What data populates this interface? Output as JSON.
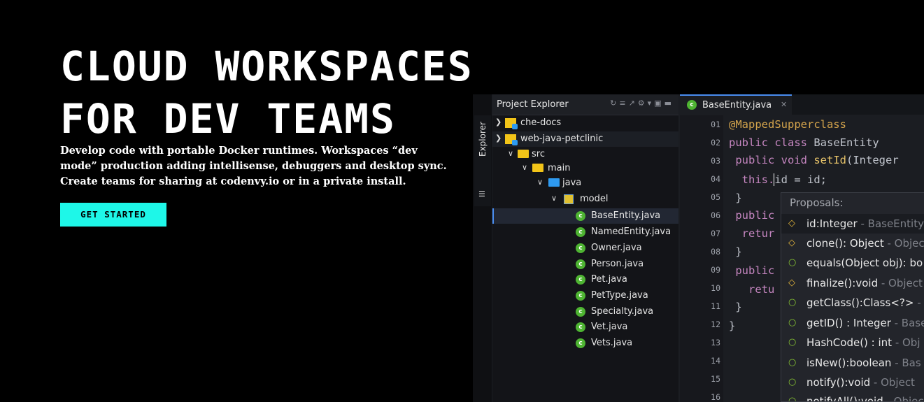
{
  "hero": {
    "title_line1": "CLOUD WORKSPACES",
    "title_line2": "FOR DEV TEAMS",
    "description": "Develop code with portable Docker runtimes. Workspaces “dev mode” production adding intellisense, debuggers and desktop sync. Create teams for sharing at codenvy.io or in a private install.",
    "cta_label": "GET STARTED"
  },
  "colors": {
    "accent": "#1ef7e8",
    "background": "#000000",
    "class_icon": "#4eb432",
    "folder": "#f2c418"
  },
  "ide": {
    "side_tab": {
      "label": "Explorer",
      "icon": "explorer-icon"
    },
    "explorer": {
      "title": "Project Explorer",
      "tool_icons": [
        "refresh-icon",
        "collapse-icon",
        "link-icon",
        "gear-icon",
        "maximize-icon",
        "minimize-icon"
      ],
      "items": [
        {
          "label": "che-docs",
          "icon": "project-icon"
        },
        {
          "label": "web-java-petclinic",
          "icon": "project-icon"
        },
        {
          "label": "src",
          "icon": "folder-icon"
        },
        {
          "label": "main",
          "icon": "folder-icon"
        },
        {
          "label": "java",
          "icon": "folder-icon"
        },
        {
          "label": "model",
          "icon": "package-icon"
        },
        {
          "label": "BaseEntity.java",
          "icon": "class-icon"
        },
        {
          "label": "NamedEntity.java",
          "icon": "class-icon"
        },
        {
          "label": "Owner.java",
          "icon": "class-icon"
        },
        {
          "label": "Person.java",
          "icon": "class-icon"
        },
        {
          "label": "Pet.java",
          "icon": "class-icon"
        },
        {
          "label": "PetType.java",
          "icon": "class-icon"
        },
        {
          "label": "Specialty.java",
          "icon": "class-icon"
        },
        {
          "label": "Vet.java",
          "icon": "class-icon"
        },
        {
          "label": "Vets.java",
          "icon": "class-icon"
        }
      ]
    },
    "editor": {
      "tab_label": "BaseEntity.java",
      "class_badge": "c",
      "line_numbers": [
        "01",
        "02",
        "03",
        "04",
        "05",
        "06",
        "07",
        "08",
        "09",
        "10",
        "11",
        "12",
        "13",
        "14",
        "15",
        "16"
      ],
      "code": {
        "l1": "@MappedSupperclass",
        "l2_kw": "public class ",
        "l2_rest": "BaseEntity",
        "l3_kw": " public void ",
        "l3_fn": "setId",
        "l3_rest": "(Integer",
        "l4_a": "  this.",
        "l4_b": "id = id;",
        "l5": " }",
        "l6": " public",
        "l7": "  retur",
        "l8": " }",
        "l9": " public",
        "l10": "   retu",
        "l11": " }",
        "l12": "}"
      }
    },
    "proposals": {
      "title": "Proposals:",
      "items": [
        {
          "name": "id:Integer",
          "type": " - BaseEntity",
          "marker": "diamond"
        },
        {
          "name": "clone(): Object",
          "type": " - Objec",
          "marker": "diamond"
        },
        {
          "name": "equals(Object obj): bo",
          "type": "",
          "marker": "circle"
        },
        {
          "name": "finalize():void",
          "type": " - Object",
          "marker": "diamond"
        },
        {
          "name": "getClass():Class<?>",
          "type": " - C",
          "marker": "circle"
        },
        {
          "name": "getID() : Integer",
          "type": " - Base",
          "marker": "circle"
        },
        {
          "name": "HashCode() : int",
          "type": " - Obj",
          "marker": "circle"
        },
        {
          "name": "isNew():boolean",
          "type": " - Bas",
          "marker": "circle"
        },
        {
          "name": "notify():void",
          "type": " - Object",
          "marker": "circle"
        },
        {
          "name": "notifyAll():void",
          "type": " - Objec",
          "marker": "circle"
        }
      ]
    }
  }
}
